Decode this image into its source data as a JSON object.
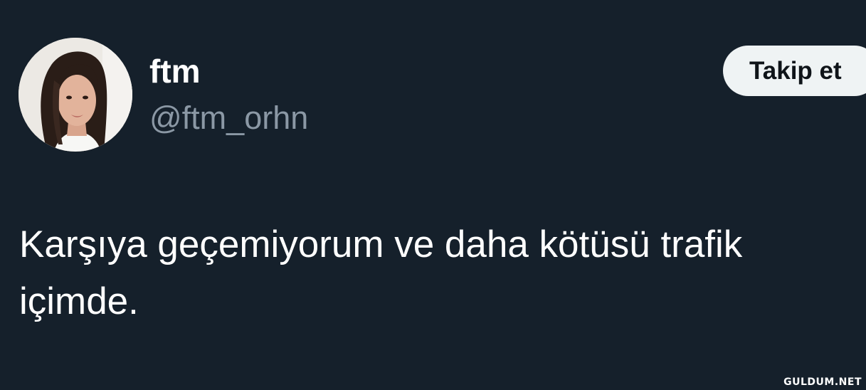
{
  "user": {
    "display_name": "ftm",
    "handle": "@ftm_orhn",
    "avatar_icon": "profile-photo"
  },
  "actions": {
    "follow_label": "Takip et"
  },
  "tweet": {
    "text": "Karşıya geçemiyorum ve daha kötüsü trafik içimde."
  },
  "watermark": "GULDUM.NET",
  "colors": {
    "background": "#15202b",
    "name": "#ffffff",
    "handle": "#8b98a5",
    "button_bg": "#eff3f4",
    "button_text": "#0f1419"
  }
}
